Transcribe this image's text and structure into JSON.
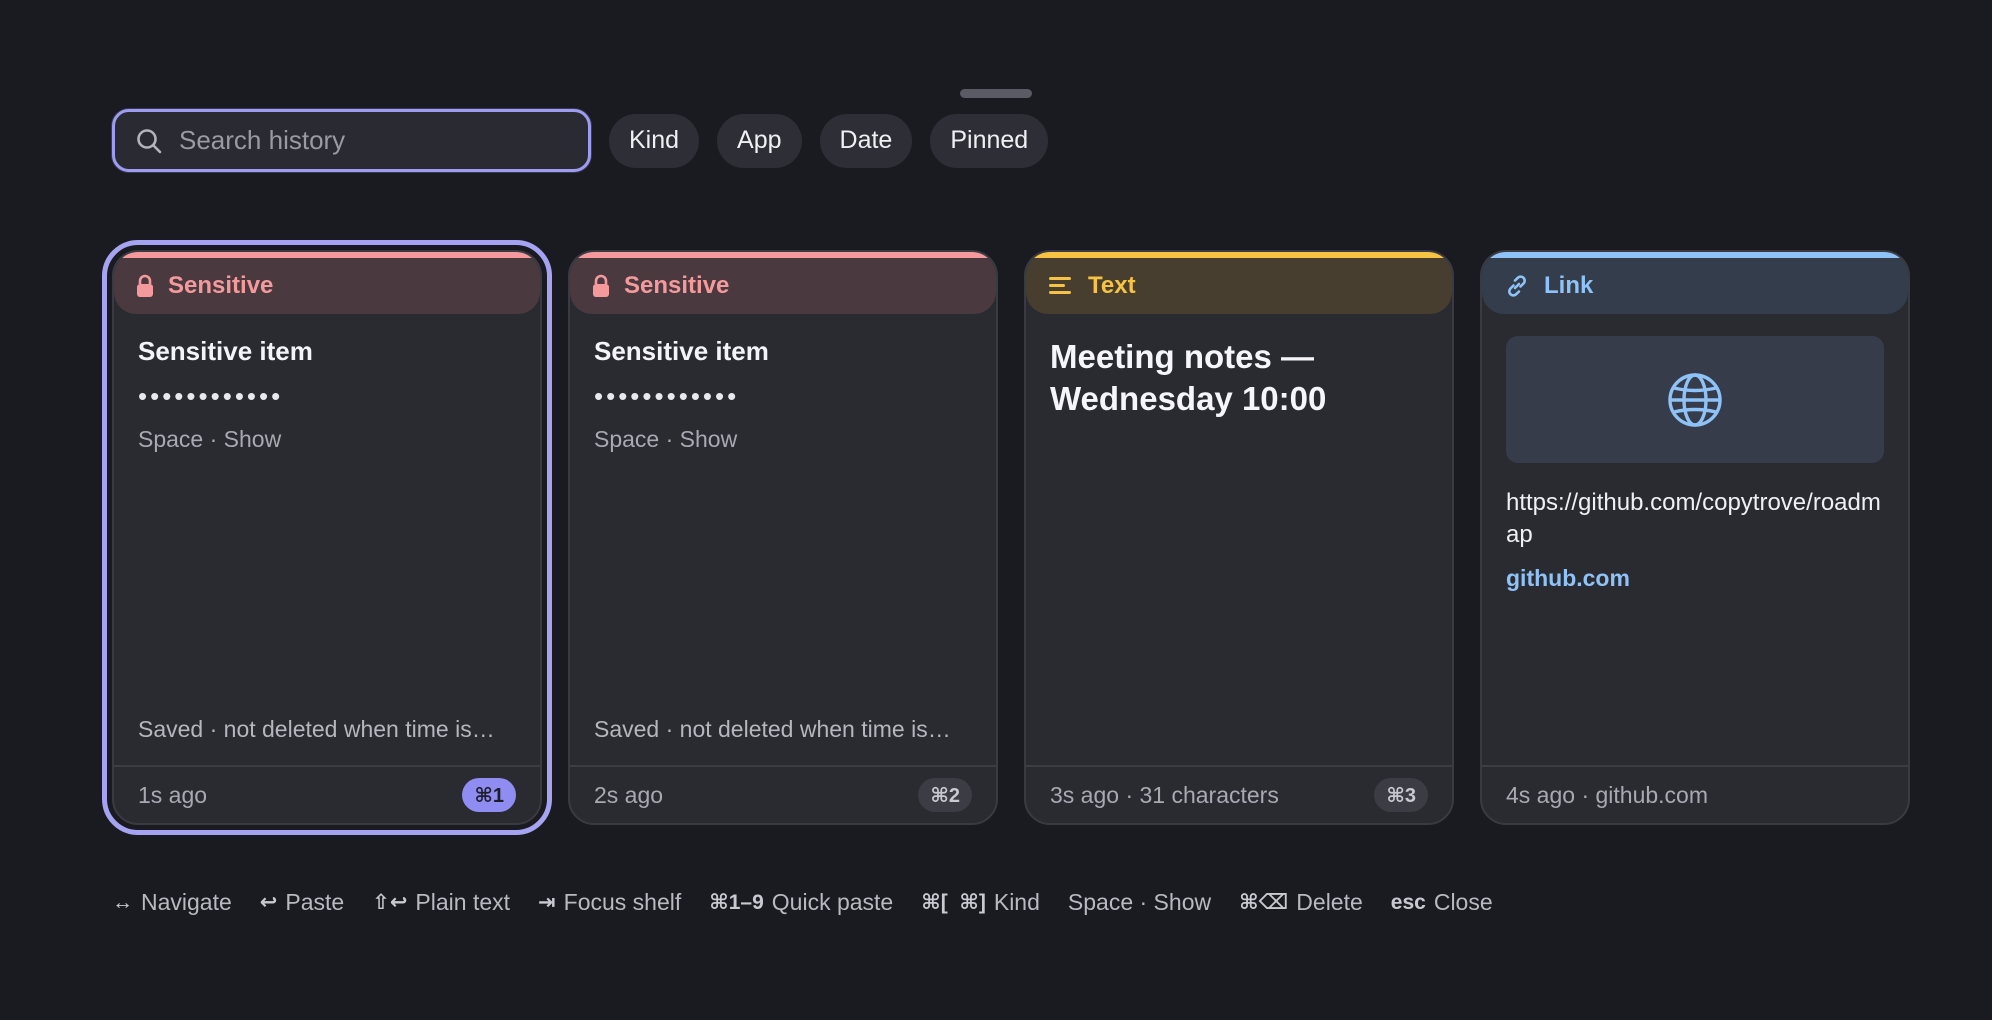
{
  "search": {
    "placeholder": "Search history"
  },
  "filters": [
    "Kind",
    "App",
    "Date",
    "Pinned"
  ],
  "colors": {
    "accent": "#a6a4f2",
    "sensitive": "#f49a9c",
    "text": "#f6c344",
    "link": "#8fc2f6"
  },
  "cards": [
    {
      "kind": "Sensitive",
      "icon": "lock-icon",
      "title": "Sensitive item",
      "masked": "••••••••••••",
      "hint": "Space · Show",
      "note": "Saved · not deleted when time is…",
      "time": "1s ago",
      "shortcut": "⌘1"
    },
    {
      "kind": "Sensitive",
      "icon": "lock-icon",
      "title": "Sensitive item",
      "masked": "••••••••••••",
      "hint": "Space · Show",
      "note": "Saved · not deleted when time is…",
      "time": "2s ago",
      "shortcut": "⌘2"
    },
    {
      "kind": "Text",
      "icon": "text-lines-icon",
      "title": "Meeting notes — Wednesday 10:00",
      "meta": "3s ago · 31 characters",
      "shortcut": "⌘3"
    },
    {
      "kind": "Link",
      "icon": "link-icon",
      "preview_icon": "globe-icon",
      "url": "https://github.com/copytrove/roadmap",
      "domain": "github.com",
      "meta": "4s ago · github.com"
    }
  ],
  "legend": [
    {
      "key": "↔",
      "label": "Navigate"
    },
    {
      "key": "↩",
      "label": "Paste"
    },
    {
      "key": "⇧↩",
      "label": "Plain text"
    },
    {
      "key": "⇥",
      "label": "Focus shelf"
    },
    {
      "key": "⌘1–9",
      "label": "Quick paste"
    },
    {
      "key": "⌘[  ⌘]",
      "label": "Kind"
    },
    {
      "key": "",
      "label": "Space · Show"
    },
    {
      "key": "⌘⌫",
      "label": "Delete"
    },
    {
      "key": "esc",
      "label": "Close"
    }
  ]
}
